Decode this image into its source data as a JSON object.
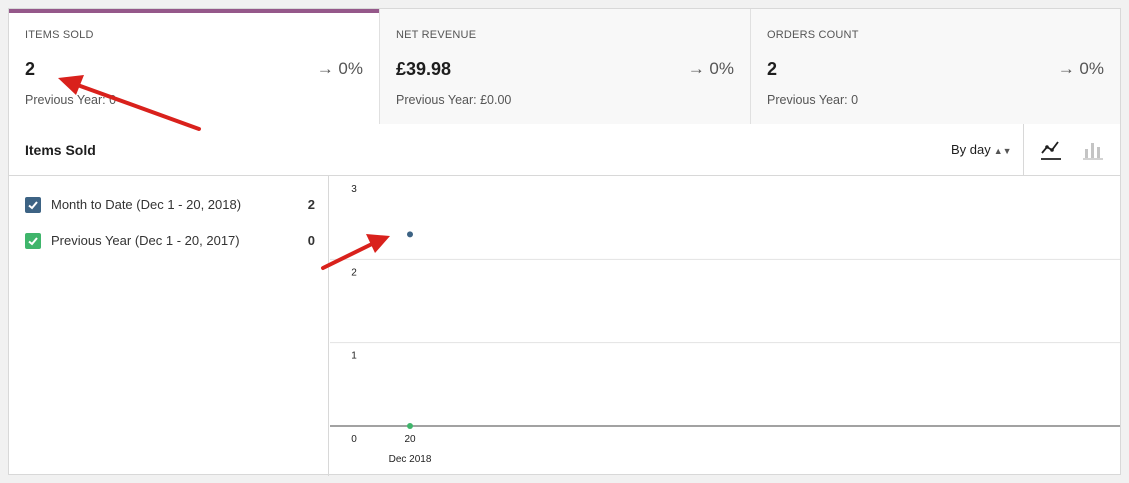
{
  "tiles": [
    {
      "label": "ITEMS SOLD",
      "value": "2",
      "delta": "→ 0%",
      "previous": "Previous Year: 0",
      "selected": true
    },
    {
      "label": "NET REVENUE",
      "value": "£39.98",
      "delta": "→ 0%",
      "previous": "Previous Year: £0.00",
      "selected": false
    },
    {
      "label": "ORDERS COUNT",
      "value": "2",
      "delta": "→ 0%",
      "previous": "Previous Year: 0",
      "selected": false
    }
  ],
  "chart_header": {
    "title": "Items Sold",
    "interval_label": "By day",
    "chart_types": [
      "line-chart-icon",
      "bar-chart-icon"
    ]
  },
  "legend": [
    {
      "label": "Month to Date (Dec 1 - 20, 2018)",
      "value": "2",
      "color": "#3d6384"
    },
    {
      "label": "Previous Year (Dec 1 - 20, 2017)",
      "value": "0",
      "color": "#3fb56b"
    }
  ],
  "colors": {
    "accent": "#95588a",
    "current": "#3d6384",
    "previous": "#3fb56b"
  },
  "chart_data": {
    "type": "line",
    "x_tick_labels": [
      "20"
    ],
    "x_group_label": "Dec 2018",
    "y_ticks": [
      0,
      1,
      2,
      3
    ],
    "ylim": [
      0,
      3
    ],
    "series": [
      {
        "name": "Month to Date (Dec 1 - 20, 2018)",
        "x": [
          "20"
        ],
        "values": [
          2.3
        ]
      },
      {
        "name": "Previous Year (Dec 1 - 20, 2017)",
        "x": [
          "20"
        ],
        "values": [
          0
        ]
      }
    ]
  }
}
